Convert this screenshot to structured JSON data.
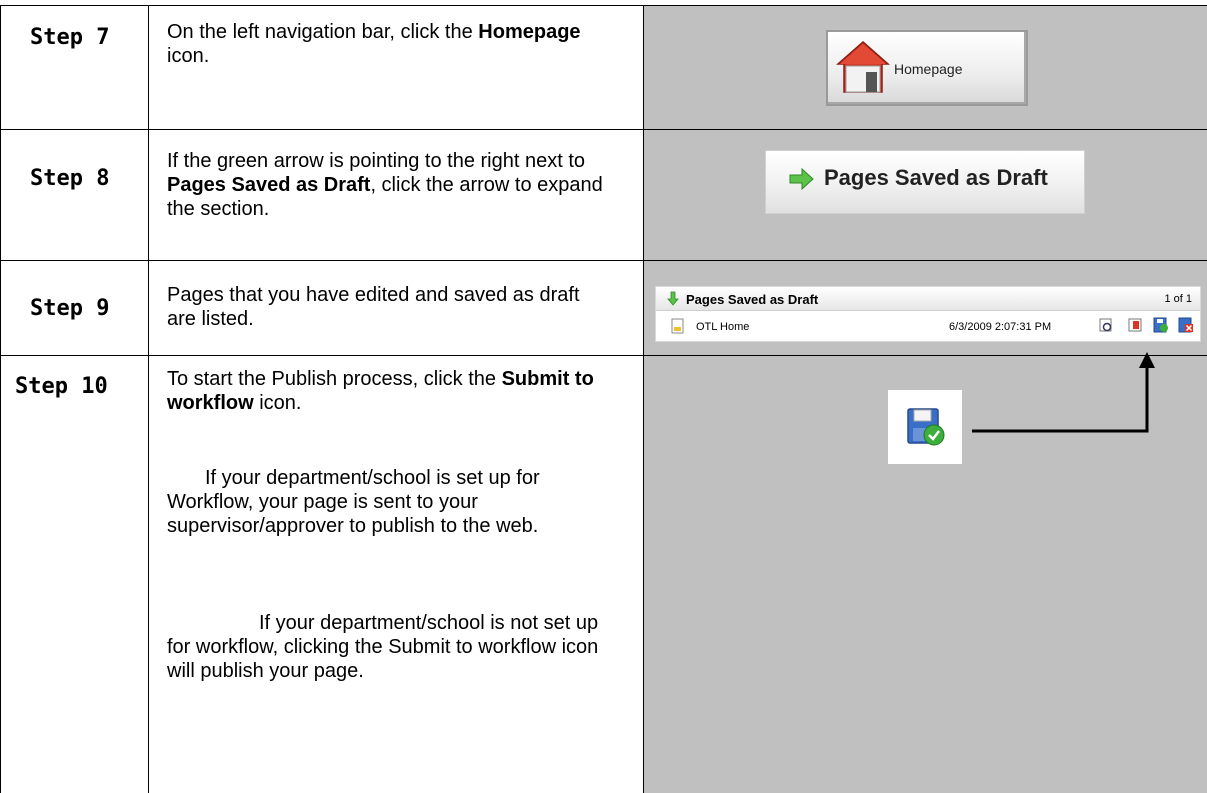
{
  "rows": [
    {
      "step": "Step 7",
      "text_parts": [
        "On the left navigation bar, click the ",
        "Homepage",
        " icon."
      ],
      "image": {
        "button_label": "Homepage"
      }
    },
    {
      "step": "Step 8",
      "text_parts": [
        "If the green arrow is pointing to the right next to ",
        "Pages Saved as Draft",
        ", click the arrow to expand the section."
      ],
      "image": {
        "title": "Pages Saved as Draft"
      }
    },
    {
      "step": "Step 9",
      "text": "Pages that you have edited and saved as draft are listed.",
      "image": {
        "panel_title": "Pages Saved as Draft",
        "count": "1 of 1",
        "row_name": "OTL Home",
        "row_date": "6/3/2009 2:07:31 PM"
      }
    },
    {
      "step": "Step 10",
      "text_parts": [
        "To start the Publish process, click the ",
        "Submit to workflow",
        " icon."
      ],
      "note1": "If your department/school is set up for Workflow, your page is sent to your supervisor/approver to publish to the web.",
      "note2": "If your department/school is not set up for workflow, clicking the Submit to workflow icon will publish your page."
    }
  ],
  "colors": {
    "image_bg": "#c0c0c0",
    "arrow_green": "#5cc24a",
    "icon_blue": "#3a6fc8"
  },
  "icons": [
    "homepage-house-icon",
    "green-right-arrow-icon",
    "green-down-arrow-icon",
    "page-icon",
    "preview-icon",
    "publish-icon",
    "submit-to-workflow-icon",
    "delete-icon",
    "callout-arrow"
  ]
}
